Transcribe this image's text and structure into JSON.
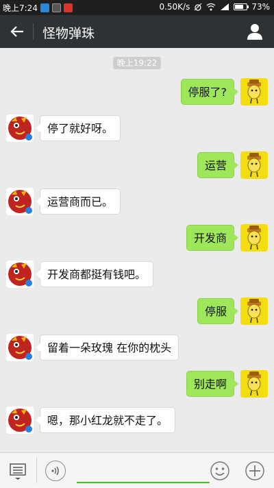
{
  "status_bar": {
    "time": "晚上7:24",
    "net_speed": "0.50K/s",
    "battery_percent": "73%",
    "battery_level": 0.73,
    "icons": [
      "upload-icon",
      "image-icon",
      "app-notification-icon",
      "alarm-icon",
      "wifi-icon",
      "signal-icon",
      "battery-icon"
    ]
  },
  "header": {
    "title": "怪物弹珠",
    "back_icon": "back-arrow-icon",
    "contact_icon": "person-icon"
  },
  "chat": {
    "timestamp": "晚上19:22",
    "messages": [
      {
        "side": "right",
        "text": "停服了?"
      },
      {
        "side": "left",
        "text": "停了就好呀。"
      },
      {
        "side": "right",
        "text": "运营"
      },
      {
        "side": "left",
        "text": "运营商而已。"
      },
      {
        "side": "right",
        "text": "开发商"
      },
      {
        "side": "left",
        "text": "开发商都挺有钱吧。"
      },
      {
        "side": "right",
        "text": "停服"
      },
      {
        "side": "left",
        "text": "留着一朵玫瑰 在你的枕头"
      },
      {
        "side": "right",
        "text": "别走啊"
      },
      {
        "side": "left",
        "text": "嗯，那小红龙就不走了。"
      }
    ]
  },
  "input_bar": {
    "text_value": "",
    "icons": [
      "menu-icon",
      "voice-icon",
      "emoji-icon",
      "plus-icon"
    ]
  },
  "colors": {
    "status_bar": "#1f1f1f",
    "title_bar": "#2f3234",
    "chat_bg": "#ebebeb",
    "my_bubble": "#9fe75a",
    "their_bubble": "#ffffff",
    "input_accent": "#45c01a"
  }
}
